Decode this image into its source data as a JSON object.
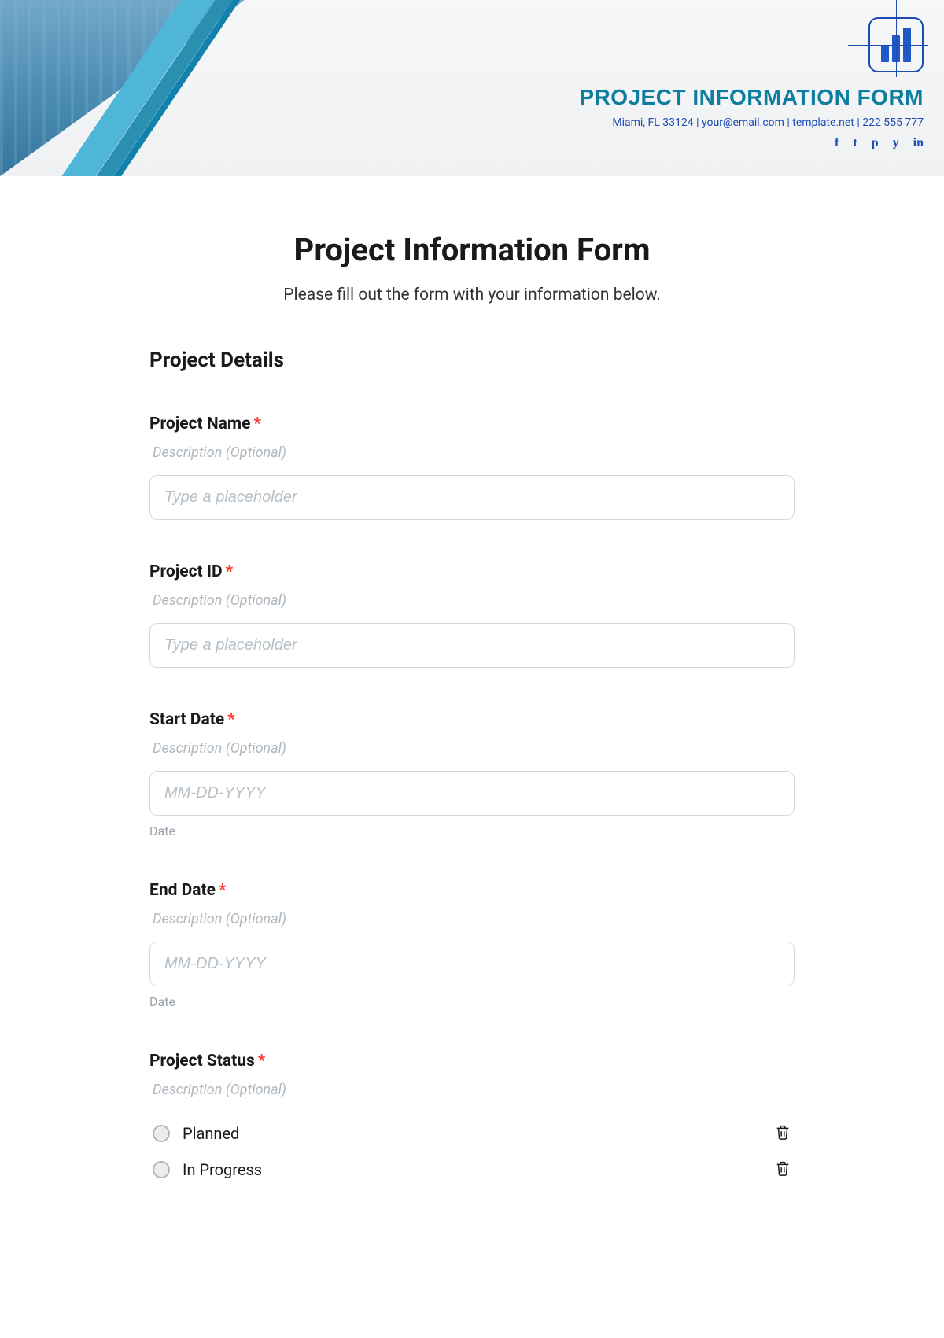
{
  "header": {
    "title": "PROJECT INFORMATION FORM",
    "contact": "Miami, FL 33124 | your@email.com | template.net | 222 555 777",
    "social": [
      "f",
      "t",
      "p",
      "y",
      "in"
    ]
  },
  "form": {
    "title": "Project Information Form",
    "subtitle": "Please fill out the form with your information below.",
    "section_title": "Project Details",
    "desc_placeholder": "Description (Optional)",
    "input_placeholder": "Type a placeholder",
    "date_placeholder": "MM-DD-YYYY",
    "date_sublabel": "Date",
    "fields": {
      "project_name": {
        "label": "Project Name"
      },
      "project_id": {
        "label": "Project ID"
      },
      "start_date": {
        "label": "Start Date"
      },
      "end_date": {
        "label": "End Date"
      },
      "project_status": {
        "label": "Project Status",
        "options": [
          "Planned",
          "In Progress"
        ]
      }
    }
  }
}
